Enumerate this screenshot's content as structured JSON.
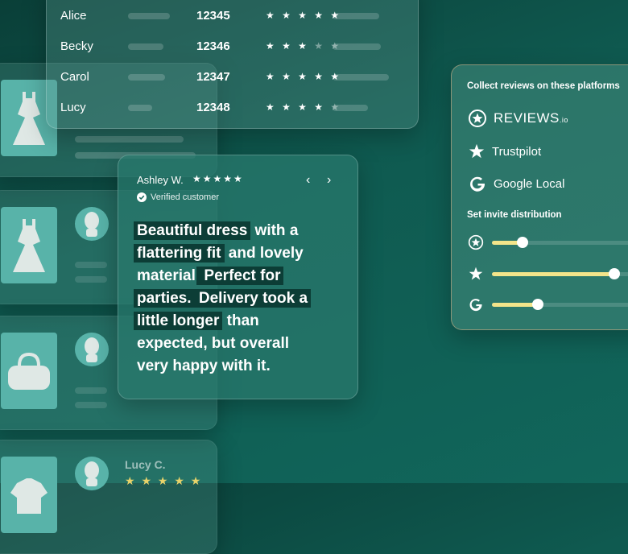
{
  "table": {
    "rows": [
      {
        "name": "Alice",
        "id": "12345",
        "stars_on": "★ ★ ★ ★ ★",
        "stars_off": ""
      },
      {
        "name": "Becky",
        "id": "12346",
        "stars_on": "★ ★ ★",
        "stars_off": " ★ ★"
      },
      {
        "name": "Carol",
        "id": "12347",
        "stars_on": "★ ★ ★ ★ ★",
        "stars_off": ""
      },
      {
        "name": "Lucy",
        "id": "12348",
        "stars_on": "★ ★ ★ ★",
        "stars_off": " ★"
      }
    ]
  },
  "review": {
    "author": "Ashley W.",
    "stars": "★★★★★",
    "verified": "Verified customer",
    "prev": "‹",
    "next": "›",
    "text": {
      "l1a": "Beautiful dress",
      "l1b": " with a",
      "l2a": "flattering fit",
      "l2b": " and lovely",
      "l3a": "material.",
      "l3b": " Perfect for",
      "l4a": "parties.",
      "l4b": " Delivery took a",
      "l5a": "little longer",
      "l5b": " than",
      "l6": "expected, but overall",
      "l7": "very happy with it."
    }
  },
  "platforms": {
    "title": "Collect reviews on these platforms",
    "items": [
      {
        "label": "REVIEWS",
        "suffix": ".io",
        "icon": "reviews-io-icon"
      },
      {
        "label": "Trustpilot",
        "suffix": "",
        "icon": "trustpilot-star-icon"
      },
      {
        "label": "Google Local",
        "suffix": "",
        "icon": "google-g-icon"
      }
    ],
    "distribution_title": "Set invite distribution",
    "distribution": [
      {
        "icon": "reviews-io-icon",
        "value": 0.2
      },
      {
        "icon": "trustpilot-star-icon",
        "value": 0.8
      },
      {
        "icon": "google-g-icon",
        "value": 0.3
      }
    ]
  },
  "product_cards": [
    {
      "thumb": "dress-icon"
    },
    {
      "thumb": "dress-icon"
    },
    {
      "thumb": "handbag-icon"
    },
    {
      "thumb": "shirt-icon",
      "name": "Lucy C.",
      "stars": "★ ★ ★ ★ ★"
    }
  ],
  "colors": {
    "accent_yellow": "#f3e48a",
    "highlight": "#0c3d36",
    "thumb": "#58b3a9"
  }
}
